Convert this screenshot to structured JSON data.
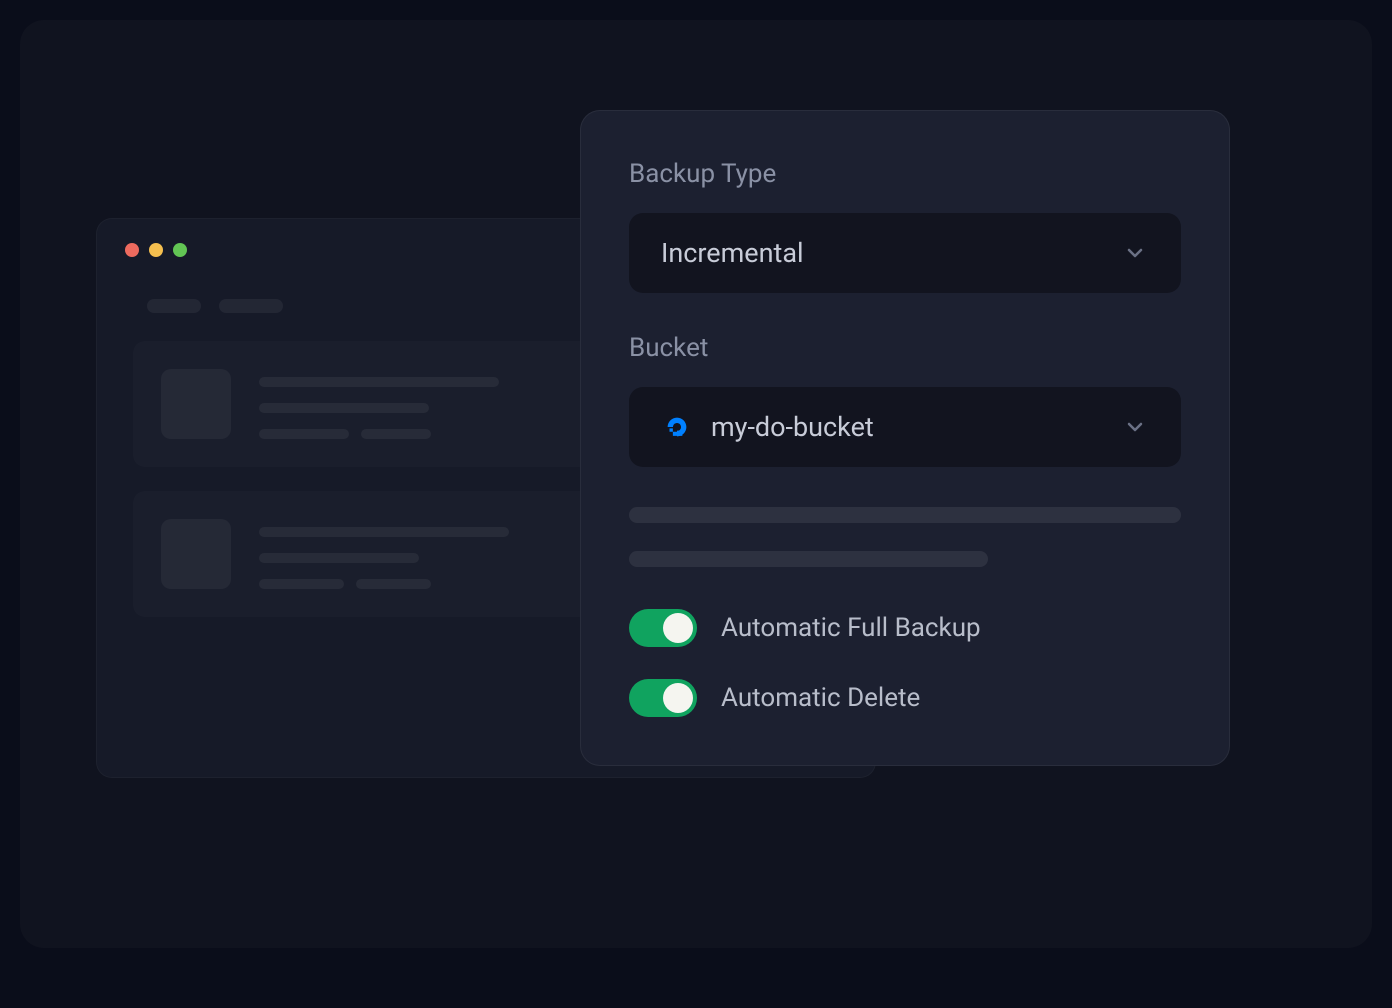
{
  "panel": {
    "backup_type_label": "Backup Type",
    "backup_type_value": "Incremental",
    "bucket_label": "Bucket",
    "bucket_value": "my-do-bucket",
    "toggles": [
      {
        "label": "Automatic Full Backup",
        "on": true
      },
      {
        "label": "Automatic Delete",
        "on": true
      }
    ]
  }
}
